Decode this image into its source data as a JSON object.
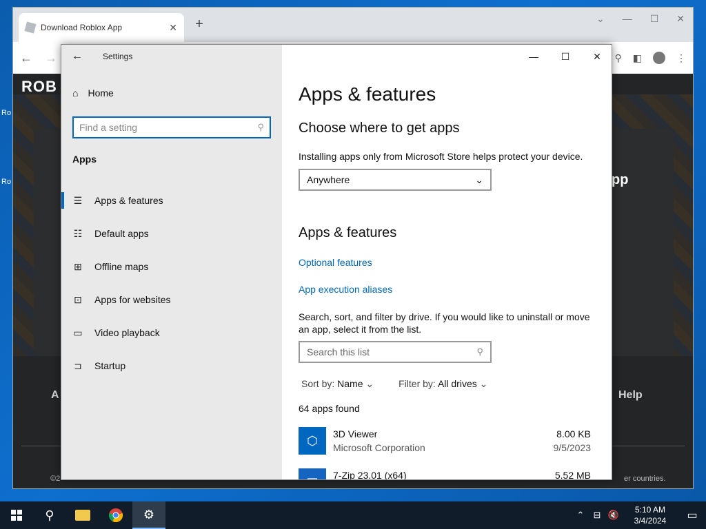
{
  "desktop": {
    "icon_labels": [
      "Ro",
      "Ro"
    ]
  },
  "browser": {
    "tab_title": "Download Roblox App",
    "new_tab_symbol": "+",
    "page": {
      "logo": "ROB",
      "hero_fragment": "pp",
      "footer_left_fragment": "A",
      "footer_help": "Help",
      "copyright_fragment": "©2",
      "copyright_tail": "er countries."
    }
  },
  "settings": {
    "window_title": "Settings",
    "home_label": "Home",
    "search": {
      "placeholder": "Find a setting"
    },
    "section_title": "Apps",
    "nav_items": [
      {
        "label": "Apps & features",
        "icon": "apps-list-icon"
      },
      {
        "label": "Default apps",
        "icon": "default-apps-icon"
      },
      {
        "label": "Offline maps",
        "icon": "map-icon"
      },
      {
        "label": "Apps for websites",
        "icon": "web-link-icon"
      },
      {
        "label": "Video playback",
        "icon": "video-icon"
      },
      {
        "label": "Startup",
        "icon": "startup-icon"
      }
    ],
    "content": {
      "page_title": "Apps & features",
      "choose_heading": "Choose where to get apps",
      "choose_desc": "Installing apps only from Microsoft Store helps protect your device.",
      "source_selected": "Anywhere",
      "section_heading": "Apps & features",
      "links": [
        "Optional features",
        "App execution aliases"
      ],
      "filter_desc": "Search, sort, and filter by drive. If you would like to uninstall or move an app, select it from the list.",
      "list_search_placeholder": "Search this list",
      "sort_label": "Sort by:",
      "sort_value": "Name",
      "filter_label": "Filter by:",
      "filter_value": "All drives",
      "apps_count": "64 apps found",
      "apps": [
        {
          "name": "3D Viewer",
          "publisher": "Microsoft Corporation",
          "size": "8.00 KB",
          "date": "9/5/2023"
        },
        {
          "name": "7-Zip 23.01 (x64)",
          "publisher": "",
          "size": "5.52 MB",
          "date": ""
        }
      ]
    }
  },
  "taskbar": {
    "time": "5:10 AM",
    "date": "3/4/2024"
  },
  "colors": {
    "accent": "#0067c0",
    "link": "#0067b8",
    "taskbar": "#101c2a"
  }
}
